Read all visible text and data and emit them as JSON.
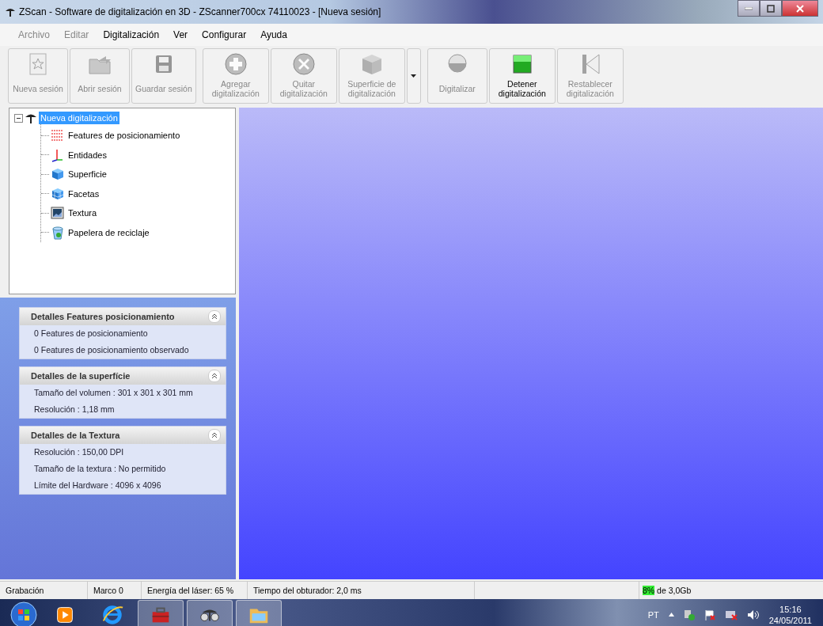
{
  "window": {
    "title": "ZScan - Software de digitalización en 3D - ZScanner700cx 74110023 - [Nueva sesión]"
  },
  "menu": [
    {
      "label": "Archivo",
      "disabled": true
    },
    {
      "label": "Editar",
      "disabled": true
    },
    {
      "label": "Digitalización",
      "disabled": false
    },
    {
      "label": "Ver",
      "disabled": false
    },
    {
      "label": "Configurar",
      "disabled": false
    },
    {
      "label": "Ayuda",
      "disabled": false
    }
  ],
  "toolbar": [
    [
      {
        "kind": "new",
        "label": "Nueva sesión",
        "disabled": true
      },
      {
        "kind": "open",
        "label": "Abrir sesión",
        "disabled": true
      },
      {
        "kind": "save",
        "label": "Guardar sesión",
        "disabled": true
      }
    ],
    [
      {
        "kind": "add",
        "label": "Agregar digitalización",
        "disabled": true
      },
      {
        "kind": "remove",
        "label": "Quitar digitalización",
        "disabled": true
      },
      {
        "kind": "surface",
        "label": "Superficie de digitalización",
        "disabled": true,
        "dropdown": true
      }
    ],
    [
      {
        "kind": "scan",
        "label": "Digitalizar",
        "disabled": true
      },
      {
        "kind": "stop",
        "label": "Detener digitalización",
        "disabled": false
      },
      {
        "kind": "reset",
        "label": "Restablecer digitalización",
        "disabled": true
      }
    ]
  ],
  "tree": {
    "label": "Nueva digitalización",
    "expanded": true,
    "selected": true,
    "children": [
      {
        "kind": "points",
        "label": "Features de posicionamiento",
        "selected": false
      },
      {
        "kind": "axes",
        "label": "Entidades",
        "selected": false
      },
      {
        "kind": "surface",
        "label": "Superficie",
        "selected": false
      },
      {
        "kind": "facets",
        "label": "Facetas",
        "selected": false
      },
      {
        "kind": "texture",
        "label": "Textura",
        "selected": false
      },
      {
        "kind": "recycle",
        "label": "Papelera de reciclaje",
        "selected": false
      }
    ]
  },
  "details": [
    {
      "title": "Detalles Features posicionamiento",
      "expanded": true,
      "lines": [
        "0 Features de posicionamiento",
        "0 Features de posicionamiento observado"
      ]
    },
    {
      "title": "Detalles de la superfície",
      "expanded": true,
      "lines": [
        "Tamaño del volumen : 301 x 301 x 301 mm",
        "Resolución : 1,18 mm"
      ]
    },
    {
      "title": "Detalles de la Textura",
      "expanded": true,
      "lines": [
        "Resolución : 150,00 DPI",
        "Tamaño de la textura : No permitido",
        "Límite del Hardware  : 4096 x 4096"
      ]
    }
  ],
  "status_bar": {
    "cells": [
      "Grabación",
      "Marco 0",
      "Energía del láser: 65 %",
      "Tiempo del obturador: 2,0 ms"
    ],
    "memory_percent": "8%",
    "memory_text": "de 3,0Gb"
  },
  "taskbar": {
    "apps": [
      {
        "kind": "media",
        "active": false
      },
      {
        "kind": "browser",
        "active": false
      },
      {
        "kind": "toolbox",
        "active": true
      },
      {
        "kind": "zscan",
        "active": true
      },
      {
        "kind": "folder",
        "active": true
      }
    ],
    "language": "PT",
    "time": "15:16",
    "date": "24/05/2011"
  }
}
